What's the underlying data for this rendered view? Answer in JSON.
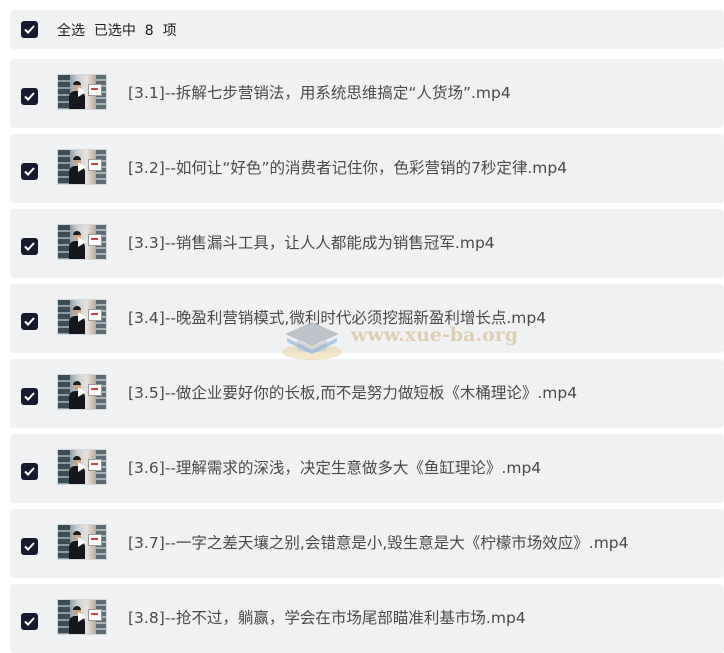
{
  "header": {
    "select_all_text": "全选  已选中  8  项",
    "checked": true
  },
  "items": [
    {
      "title": "[3.1]--拆解七步营销法，用系统思维搞定“人货场”.mp4",
      "checked": true
    },
    {
      "title": "[3.2]--如何让“好色”的消费者记住你，色彩营销的7秒定律.mp4",
      "checked": true
    },
    {
      "title": "[3.3]--销售漏斗工具，让人人都能成为销售冠军.mp4",
      "checked": true
    },
    {
      "title": "[3.4]--晚盈利营销模式,微利时代必须挖掘新盈利增长点.mp4",
      "checked": true
    },
    {
      "title": "[3.5]--做企业要好你的长板,而不是努力做短板《木桶理论》.mp4",
      "checked": true
    },
    {
      "title": "[3.6]--理解需求的深浅，决定生意做多大《鱼缸理论》.mp4",
      "checked": true
    },
    {
      "title": "[3.7]--一字之差天壤之别,会错意是小,毁生意是大《柠檬市场效应》.mp4",
      "checked": true
    },
    {
      "title": "[3.8]--抢不过，躺赢，学会在市场尾部瞄准利基市场.mp4",
      "checked": true
    }
  ],
  "watermark": {
    "text": "www.xue-ba.org"
  }
}
